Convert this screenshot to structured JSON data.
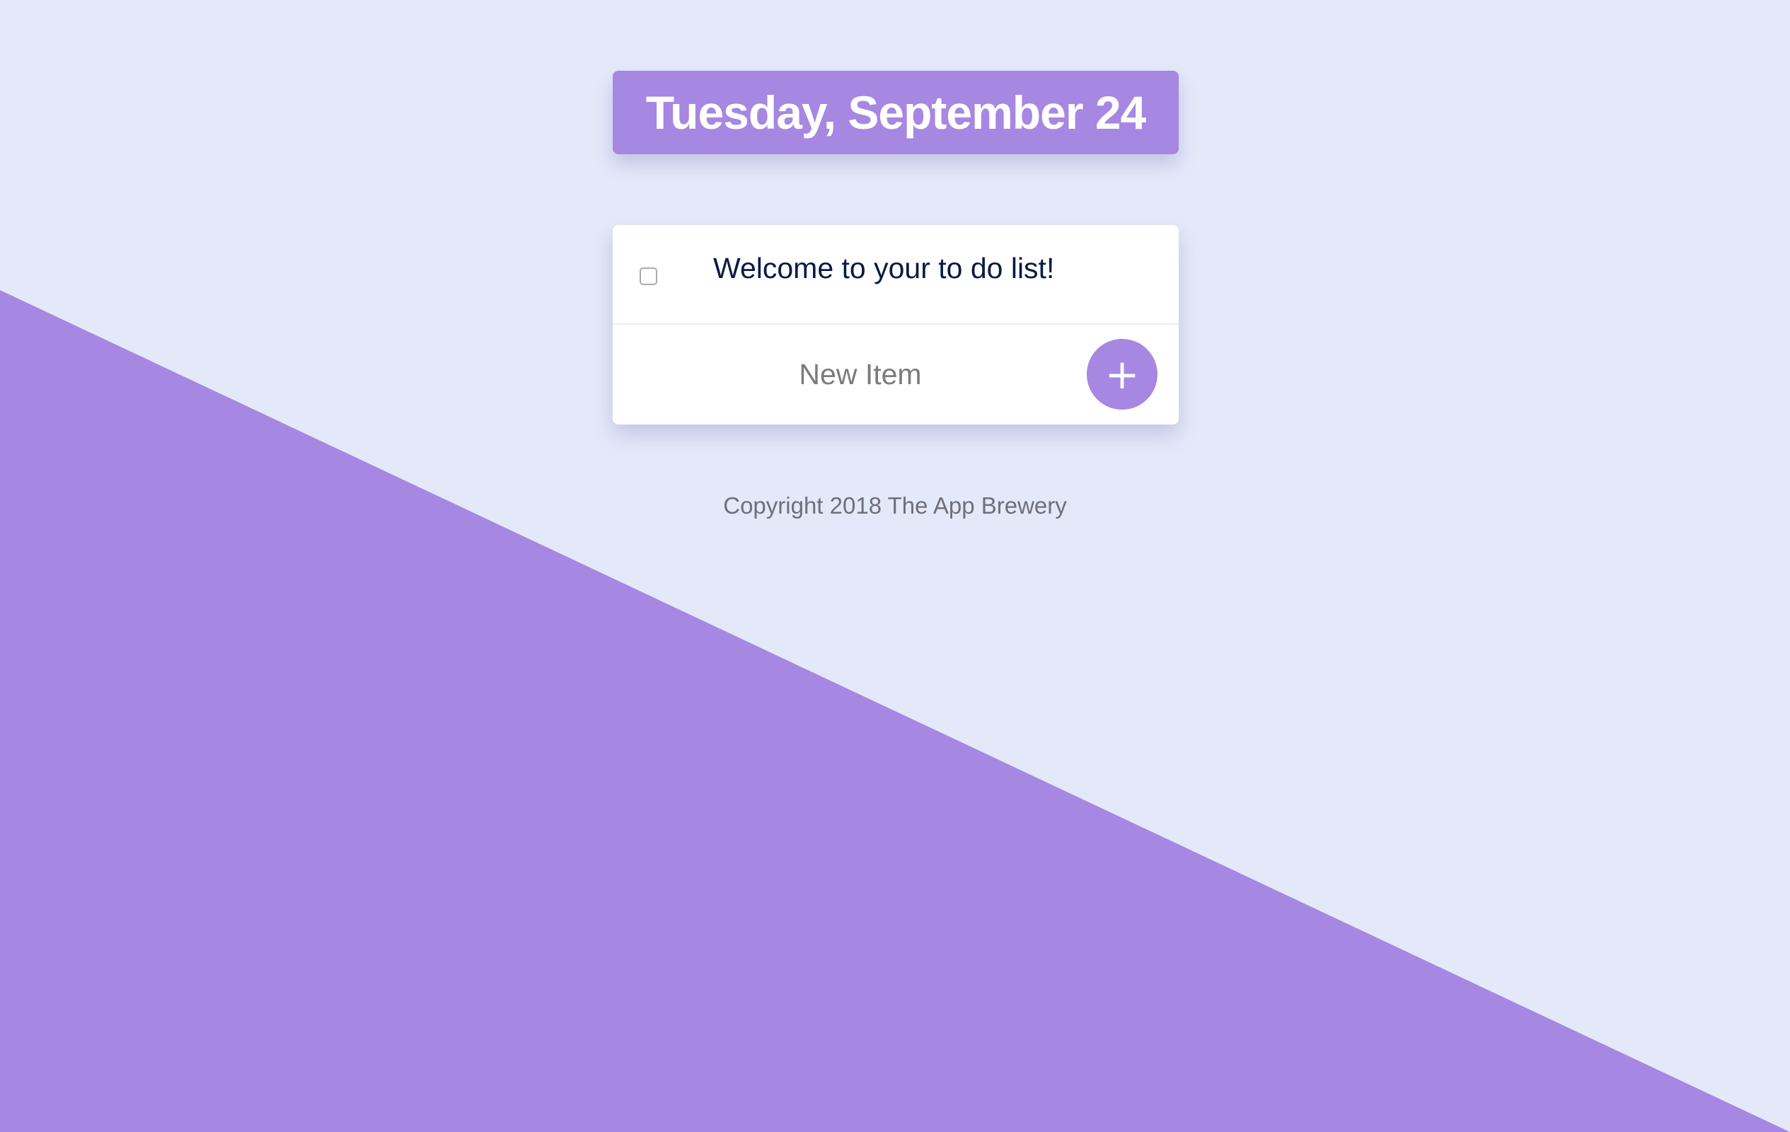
{
  "colors": {
    "background": "#e4e9fa",
    "accent": "#a687e2",
    "item_text": "#0a1a45",
    "footer_text": "#6f6f78"
  },
  "heading": {
    "date": "Tuesday, September 24"
  },
  "list": {
    "items": [
      {
        "text": "Welcome to your to do list!",
        "checked": false
      }
    ],
    "new_item": {
      "placeholder": "New Item",
      "value": ""
    },
    "add_button": {
      "label": "+",
      "icon": "plus-icon"
    }
  },
  "footer": {
    "copyright": "Copyright 2018 The App Brewery"
  }
}
